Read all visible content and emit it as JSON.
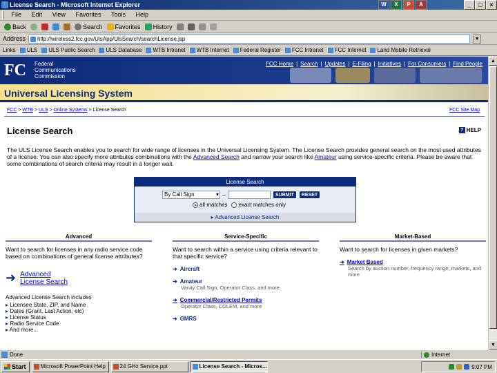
{
  "window": {
    "title": "License Search - Microsoft Internet Explorer",
    "office_apps": [
      "Word",
      "Excel",
      "PowerPoint",
      "Access"
    ],
    "controls": [
      "_",
      "□",
      "×"
    ]
  },
  "menu": [
    "File",
    "Edit",
    "View",
    "Favorites",
    "Tools",
    "Help"
  ],
  "toolbar": {
    "back": "Back",
    "search": "Search",
    "favorites": "Favorites",
    "history": "History"
  },
  "address": {
    "label": "Address",
    "value": "http://wireless2.fcc.gov/UlsApp/UlsSearch/searchLicense.jsp"
  },
  "links": [
    "Links",
    "ULS",
    "ULS Public Search",
    "ULS Database",
    "WTB Intranet",
    "WTB Internet",
    "Federal Register",
    "FCC Intranet",
    "FCC Internet",
    "Land Mobile Retrieval"
  ],
  "fcc": {
    "logo": "FC",
    "name_lines": [
      "Federal",
      "Communications",
      "Commission"
    ],
    "nav": [
      "FCC Home",
      "Search",
      "Updates",
      "E-Filing",
      "Initiatives",
      "For Consumers",
      "Find People"
    ]
  },
  "banner": {
    "title": "Universal Licensing System"
  },
  "breadcrumb": {
    "items": [
      "FCC",
      "WTB",
      "ULS",
      "Online Systems"
    ],
    "current": "License Search",
    "separator": " > ",
    "sitemap": "FCC Site Map"
  },
  "page": {
    "title": "License Search",
    "help": "HELP",
    "intro_part1": "The ULS License Search enables you to search for wide range of licenses in the Universal Licensing System. The License Search provides general search on the most used attributes of a license. You can also specify more attributes combinations with the ",
    "intro_link1": "Advanced Search",
    "intro_part2": " and narrow your search like ",
    "intro_link2": "Amateur",
    "intro_part3": " using service-specific criteria. Please be aware that some combinations of search criteria may result in a longer wait."
  },
  "search": {
    "heading": "License Search",
    "select_value": "By Call Sign",
    "dash": "–",
    "submit": "SUBMIT",
    "reset": "RESET",
    "radio_all": "all matches",
    "radio_exact": "exact matches only",
    "advanced_link": "Advanced License Search"
  },
  "columns": {
    "advanced": {
      "heading": "Advanced",
      "question": "Want to search for licenses in any radio service code based on combinations of general license attributes?",
      "link_line1": "Advanced",
      "link_line2": "License Search",
      "includes": "Advanced License Search includes",
      "list": [
        "Licensee State, ZIP, and Name",
        "Dates (Grant, Last Action, etc)",
        "License Status",
        "Radio Service Code",
        "And more..."
      ]
    },
    "service": {
      "heading": "Service-Specific",
      "question": "Want to search within a service using criteria relevant to that specific service?",
      "items": [
        {
          "title": "Aircraft",
          "desc": ""
        },
        {
          "title": "Amateur",
          "desc": "Vanity Call Sign, Operator Class, and more"
        },
        {
          "title": "Commercial/Restricted Permits",
          "desc": "Operator Class, COLEM, and more"
        },
        {
          "title": "GMRS",
          "desc": ""
        }
      ]
    },
    "market": {
      "heading": "Market-Based",
      "question": "Want to search for licenses in given markets?",
      "items": [
        {
          "title": "Market Based",
          "desc": "Search by auction number, frequency range, markets, and more"
        }
      ]
    }
  },
  "status": {
    "text": "Done",
    "zone": "Internet"
  },
  "taskbar": {
    "start": "Start",
    "tasks": [
      "Microsoft PowerPoint Help",
      "24 GHz Service.ppt",
      "License Search - Micros..."
    ],
    "clock": "9:07 PM"
  },
  "colors": {
    "fcc_blue": "#0b2a7a",
    "banner_gold": "#f7e08a",
    "link_blue": "#0000cc"
  }
}
